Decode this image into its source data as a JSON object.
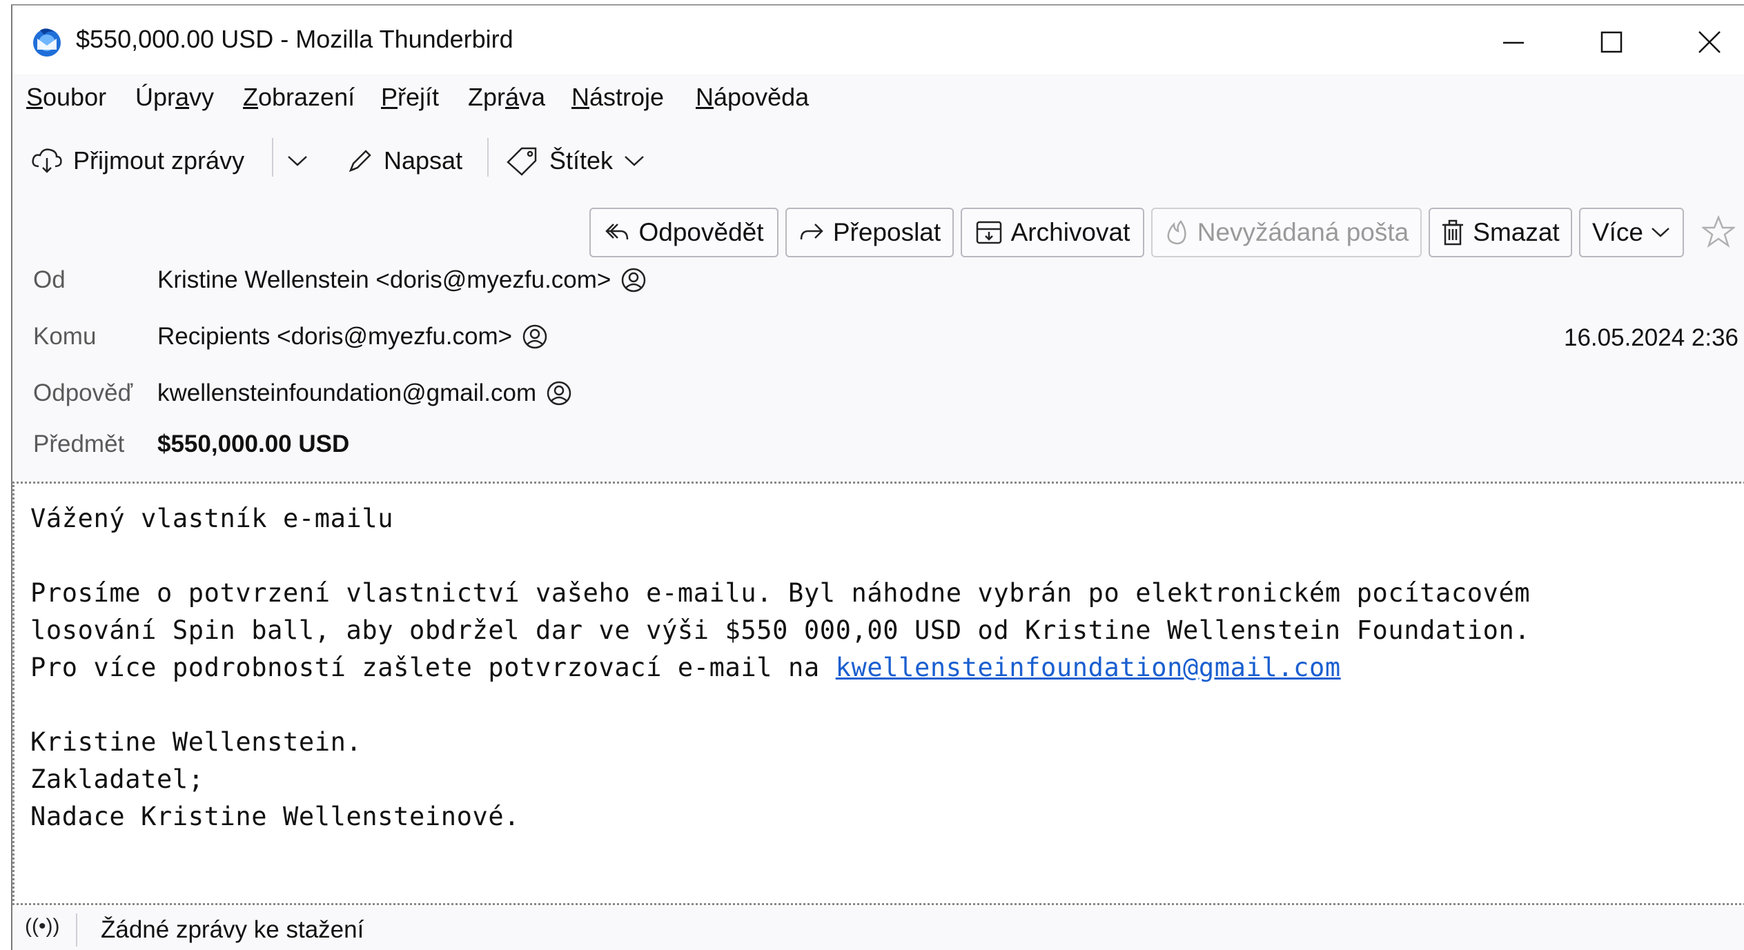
{
  "window": {
    "title": "$550,000.00 USD - Mozilla Thunderbird"
  },
  "menu": [
    {
      "pre": "",
      "key": "S",
      "post": "oubor"
    },
    {
      "pre": "Úpr",
      "key": "a",
      "post": "vy"
    },
    {
      "pre": "",
      "key": "Z",
      "post": "obrazení"
    },
    {
      "pre": "",
      "key": "P",
      "post": "řejít"
    },
    {
      "pre": "Zpr",
      "key": "á",
      "post": "va"
    },
    {
      "pre": "",
      "key": "N",
      "post": "ástroje"
    },
    {
      "pre": "",
      "key": "N",
      "post": "ápověda"
    }
  ],
  "toolbar": {
    "get_messages": "Přijmout zprávy",
    "write": "Napsat",
    "tag": "Štítek"
  },
  "header_buttons": {
    "reply": "Odpovědět",
    "forward": "Přeposlat",
    "archive": "Archivovat",
    "junk": "Nevyžádaná pošta",
    "delete": "Smazat",
    "more": "Více"
  },
  "headers": {
    "from_label": "Od",
    "from_value": "Kristine Wellenstein <doris@myezfu.com>",
    "to_label": "Komu",
    "to_value": "Recipients <doris@myezfu.com>",
    "reply_to_label": "Odpověď",
    "reply_to_value": "kwellensteinfoundation@gmail.com",
    "subject_label": "Předmět",
    "subject_value": "$550,000.00 USD",
    "date": "16.05.2024 2:36"
  },
  "body": {
    "greeting": "Vážený vlastník e-mailu",
    "p1_line1": "Prosíme o potvrzení vlastnictví vašeho e-mailu. Byl náhodne vybrán po elektronickém pocítacovém",
    "p1_line2": "losování Spin ball, aby obdržel dar ve výši $550 000,00 USD od Kristine Wellenstein Foundation.",
    "p1_line3_prefix": "Pro více podrobností zašlete potvrzovací e-mail na ",
    "p1_link": "kwellensteinfoundation@gmail.com",
    "sig1": "Kristine Wellenstein.",
    "sig2": "Zakladatel;",
    "sig3": "Nadace Kristine Wellensteinové."
  },
  "status": {
    "text": "Žádné zprávy ke stažení"
  }
}
